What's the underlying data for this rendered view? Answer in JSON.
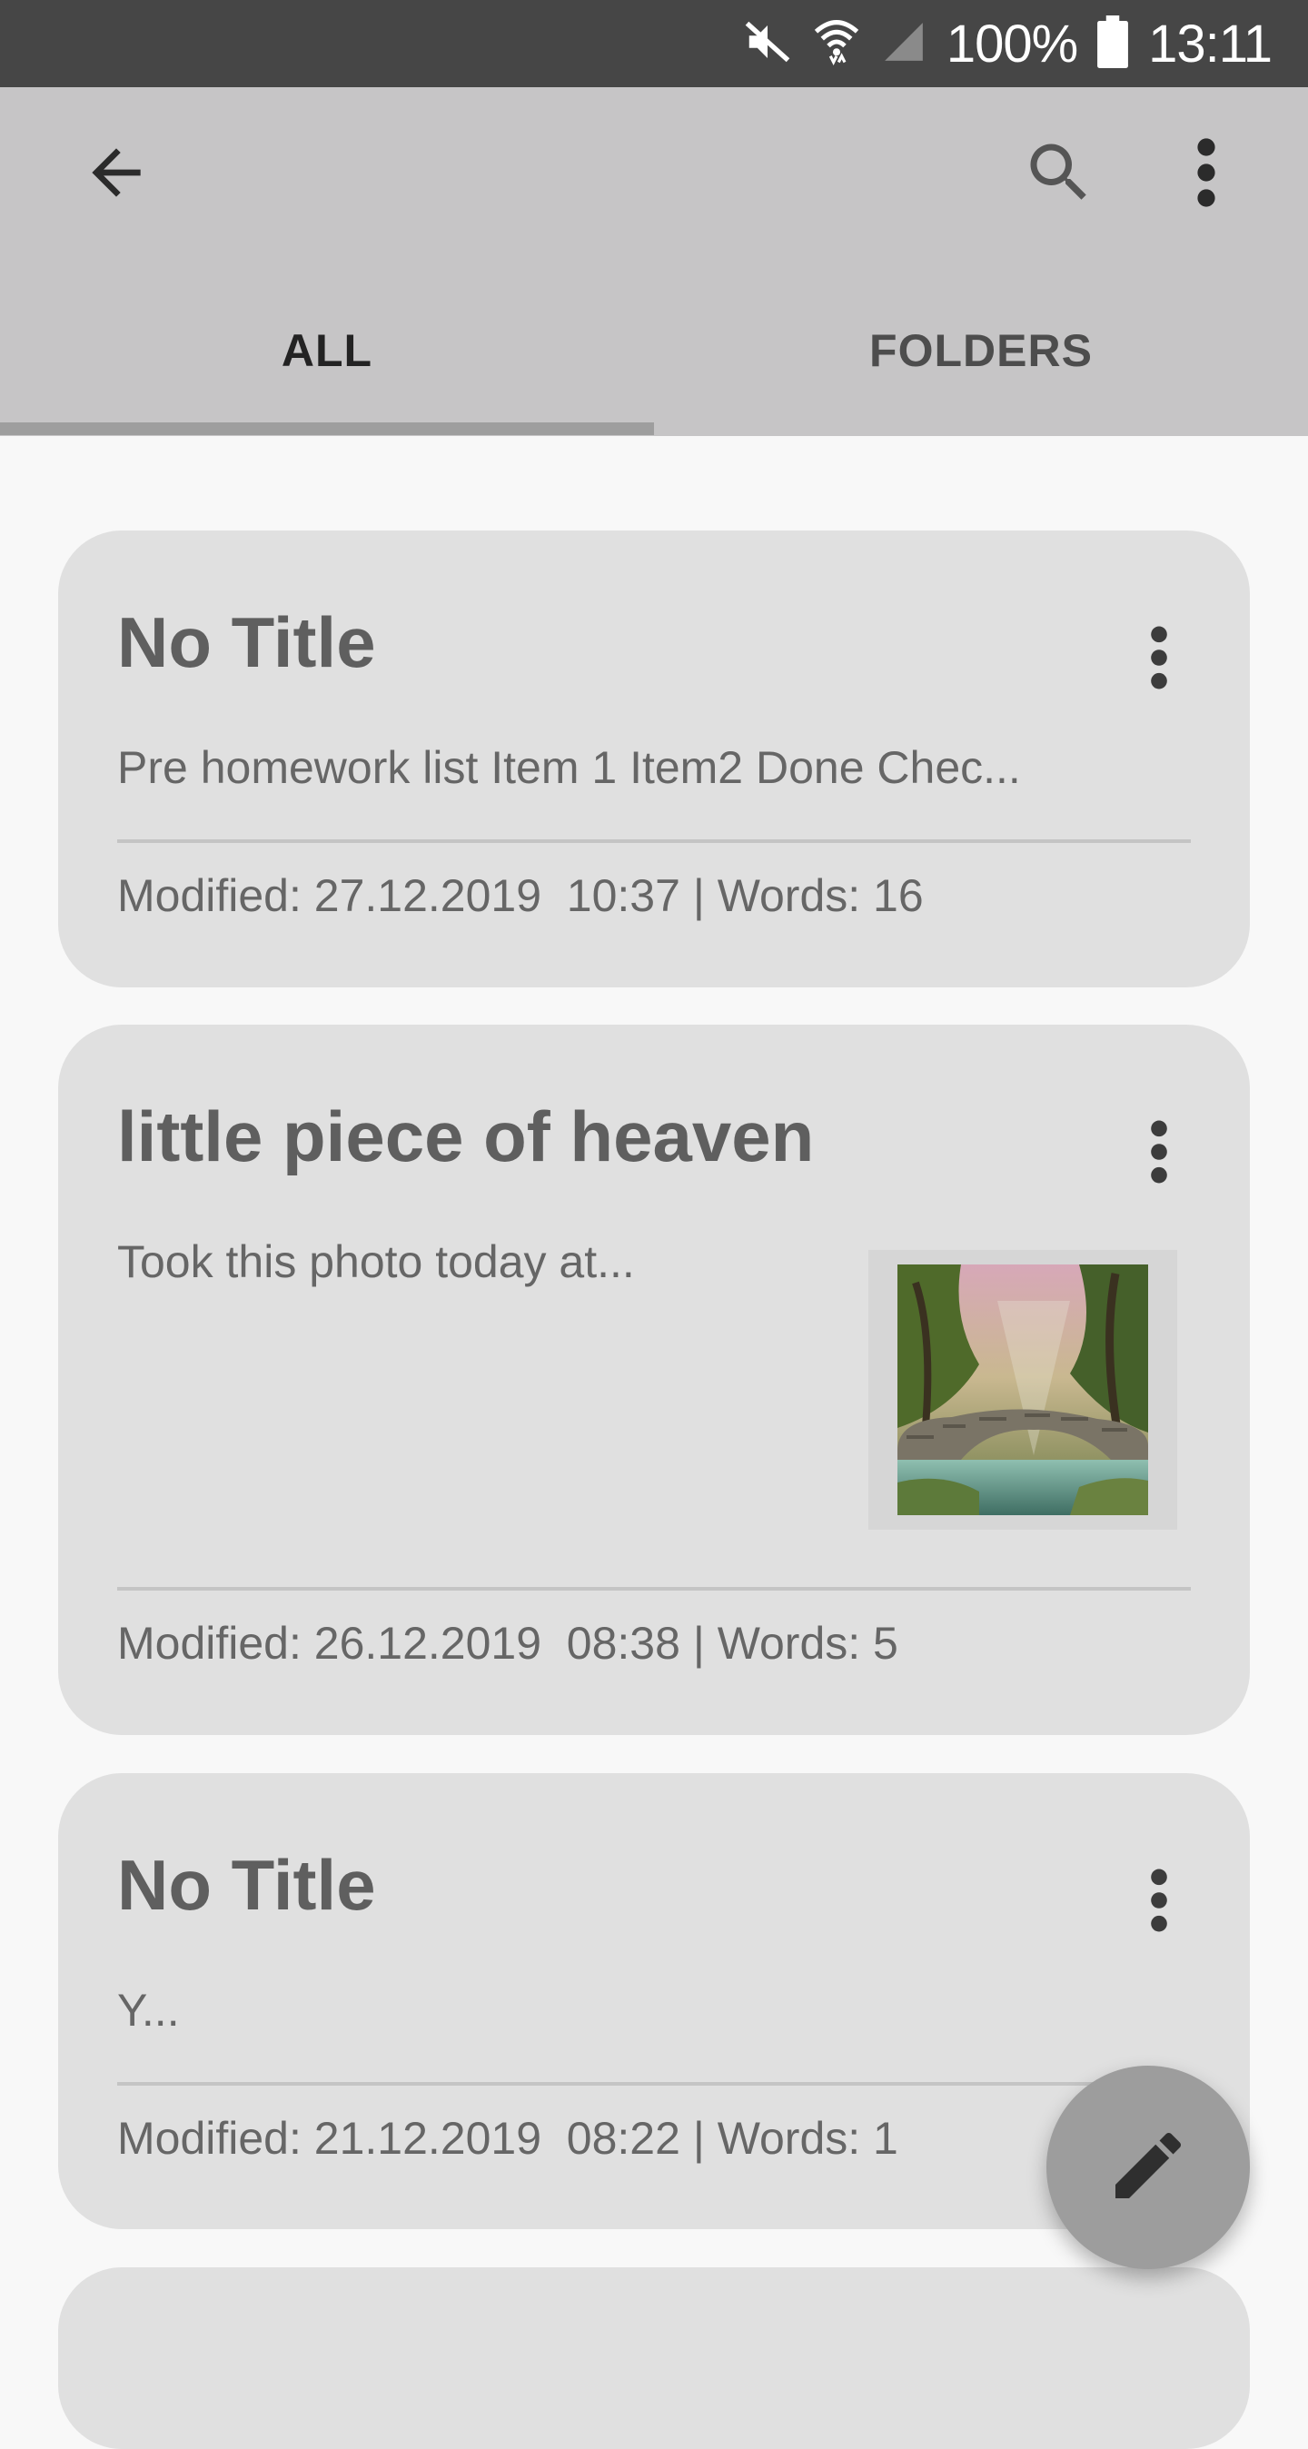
{
  "status_bar": {
    "battery": "100%",
    "time": "13:11",
    "icons": [
      "mute-icon",
      "wifi-icon",
      "signal-icon",
      "battery-icon"
    ]
  },
  "app_bar": {
    "icons": [
      "back-arrow-icon",
      "search-icon",
      "more-vert-icon"
    ]
  },
  "tabs": [
    {
      "label": "ALL",
      "selected": true
    },
    {
      "label": "FOLDERS",
      "selected": false
    }
  ],
  "notes": [
    {
      "title": "No Title",
      "preview": "Pre homework list Item 1 Item2 Done Chec...",
      "meta": "Modified: 27.12.2019  10:37 | Words: 16"
    },
    {
      "title": "little piece of heaven",
      "preview": "Took this photo today at...",
      "meta": "Modified: 26.12.2019  08:38 | Words: 5",
      "thumbnail": "forest-bridge-photo"
    },
    {
      "title": "No Title",
      "preview": "Y...",
      "meta": "Modified: 21.12.2019  08:22 | Words: 1"
    }
  ],
  "fab": {
    "icon": "pencil-edit-icon"
  },
  "colors": {
    "status_bar": "#464646",
    "app_bar": "#c6c5c6",
    "card": "#e0e0e0",
    "background": "#f8f8f8",
    "fab": "#9d9d9d"
  }
}
